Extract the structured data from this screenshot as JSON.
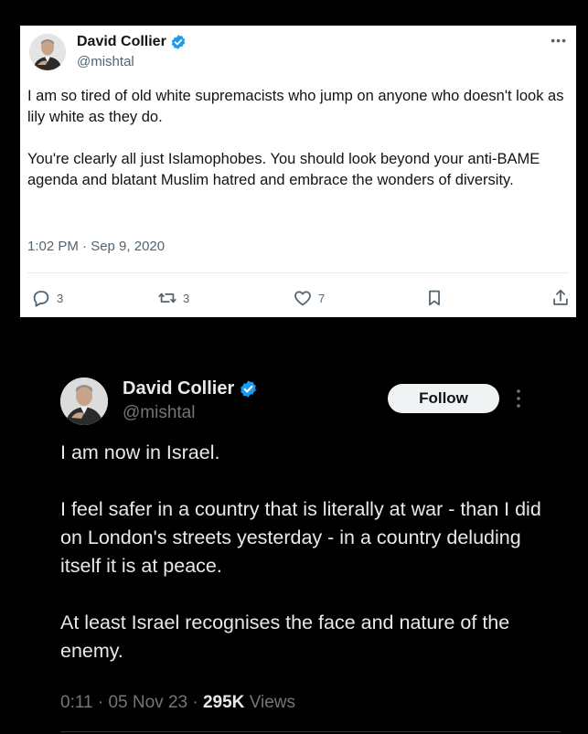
{
  "top_tweet": {
    "author_name": "David Collier",
    "handle": "@mishtal",
    "more_icon": "more-horizontal-icon",
    "verified_color": "#1d9bf0",
    "paragraphs": [
      "I am so tired of old white supremacists who jump on anyone who doesn't look as lily white as they do.",
      "You're clearly all just Islamophobes. You should look beyond your anti-BAME agenda and blatant Muslim hatred and embrace the wonders of diversity."
    ],
    "timestamp": "1:02 PM · Sep 9, 2020",
    "actions": {
      "reply_count": "3",
      "retweet_count": "3",
      "like_count": "7"
    }
  },
  "bottom_tweet": {
    "author_name": "David Collier",
    "handle": "@mishtal",
    "follow_label": "Follow",
    "verified_color": "#1d9bf0",
    "paragraphs": [
      "I am now in Israel.",
      "I feel safer in a country that is literally at war - than I did on London's streets yesterday - in a country deluding itself it is at peace.",
      "At least Israel recognises the face and nature of the enemy."
    ],
    "time": "0:11",
    "date": "05 Nov 23",
    "views_count": "295K",
    "views_label": "Views"
  }
}
